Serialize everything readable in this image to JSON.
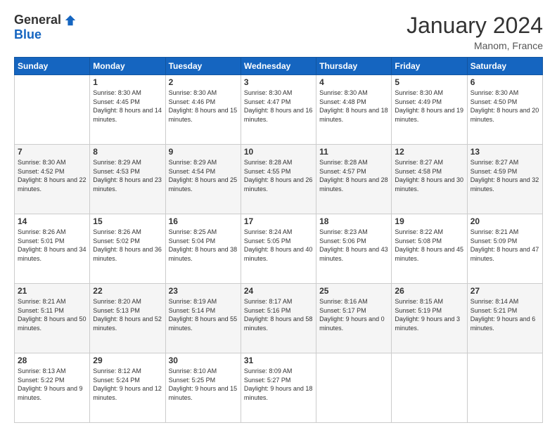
{
  "header": {
    "logo_general": "General",
    "logo_blue": "Blue",
    "month_title": "January 2024",
    "location": "Manom, France"
  },
  "days_of_week": [
    "Sunday",
    "Monday",
    "Tuesday",
    "Wednesday",
    "Thursday",
    "Friday",
    "Saturday"
  ],
  "weeks": [
    [
      {
        "day": "",
        "sunrise": "",
        "sunset": "",
        "daylight": ""
      },
      {
        "day": "1",
        "sunrise": "Sunrise: 8:30 AM",
        "sunset": "Sunset: 4:45 PM",
        "daylight": "Daylight: 8 hours and 14 minutes."
      },
      {
        "day": "2",
        "sunrise": "Sunrise: 8:30 AM",
        "sunset": "Sunset: 4:46 PM",
        "daylight": "Daylight: 8 hours and 15 minutes."
      },
      {
        "day": "3",
        "sunrise": "Sunrise: 8:30 AM",
        "sunset": "Sunset: 4:47 PM",
        "daylight": "Daylight: 8 hours and 16 minutes."
      },
      {
        "day": "4",
        "sunrise": "Sunrise: 8:30 AM",
        "sunset": "Sunset: 4:48 PM",
        "daylight": "Daylight: 8 hours and 18 minutes."
      },
      {
        "day": "5",
        "sunrise": "Sunrise: 8:30 AM",
        "sunset": "Sunset: 4:49 PM",
        "daylight": "Daylight: 8 hours and 19 minutes."
      },
      {
        "day": "6",
        "sunrise": "Sunrise: 8:30 AM",
        "sunset": "Sunset: 4:50 PM",
        "daylight": "Daylight: 8 hours and 20 minutes."
      }
    ],
    [
      {
        "day": "7",
        "sunrise": "Sunrise: 8:30 AM",
        "sunset": "Sunset: 4:52 PM",
        "daylight": "Daylight: 8 hours and 22 minutes."
      },
      {
        "day": "8",
        "sunrise": "Sunrise: 8:29 AM",
        "sunset": "Sunset: 4:53 PM",
        "daylight": "Daylight: 8 hours and 23 minutes."
      },
      {
        "day": "9",
        "sunrise": "Sunrise: 8:29 AM",
        "sunset": "Sunset: 4:54 PM",
        "daylight": "Daylight: 8 hours and 25 minutes."
      },
      {
        "day": "10",
        "sunrise": "Sunrise: 8:28 AM",
        "sunset": "Sunset: 4:55 PM",
        "daylight": "Daylight: 8 hours and 26 minutes."
      },
      {
        "day": "11",
        "sunrise": "Sunrise: 8:28 AM",
        "sunset": "Sunset: 4:57 PM",
        "daylight": "Daylight: 8 hours and 28 minutes."
      },
      {
        "day": "12",
        "sunrise": "Sunrise: 8:27 AM",
        "sunset": "Sunset: 4:58 PM",
        "daylight": "Daylight: 8 hours and 30 minutes."
      },
      {
        "day": "13",
        "sunrise": "Sunrise: 8:27 AM",
        "sunset": "Sunset: 4:59 PM",
        "daylight": "Daylight: 8 hours and 32 minutes."
      }
    ],
    [
      {
        "day": "14",
        "sunrise": "Sunrise: 8:26 AM",
        "sunset": "Sunset: 5:01 PM",
        "daylight": "Daylight: 8 hours and 34 minutes."
      },
      {
        "day": "15",
        "sunrise": "Sunrise: 8:26 AM",
        "sunset": "Sunset: 5:02 PM",
        "daylight": "Daylight: 8 hours and 36 minutes."
      },
      {
        "day": "16",
        "sunrise": "Sunrise: 8:25 AM",
        "sunset": "Sunset: 5:04 PM",
        "daylight": "Daylight: 8 hours and 38 minutes."
      },
      {
        "day": "17",
        "sunrise": "Sunrise: 8:24 AM",
        "sunset": "Sunset: 5:05 PM",
        "daylight": "Daylight: 8 hours and 40 minutes."
      },
      {
        "day": "18",
        "sunrise": "Sunrise: 8:23 AM",
        "sunset": "Sunset: 5:06 PM",
        "daylight": "Daylight: 8 hours and 43 minutes."
      },
      {
        "day": "19",
        "sunrise": "Sunrise: 8:22 AM",
        "sunset": "Sunset: 5:08 PM",
        "daylight": "Daylight: 8 hours and 45 minutes."
      },
      {
        "day": "20",
        "sunrise": "Sunrise: 8:21 AM",
        "sunset": "Sunset: 5:09 PM",
        "daylight": "Daylight: 8 hours and 47 minutes."
      }
    ],
    [
      {
        "day": "21",
        "sunrise": "Sunrise: 8:21 AM",
        "sunset": "Sunset: 5:11 PM",
        "daylight": "Daylight: 8 hours and 50 minutes."
      },
      {
        "day": "22",
        "sunrise": "Sunrise: 8:20 AM",
        "sunset": "Sunset: 5:13 PM",
        "daylight": "Daylight: 8 hours and 52 minutes."
      },
      {
        "day": "23",
        "sunrise": "Sunrise: 8:19 AM",
        "sunset": "Sunset: 5:14 PM",
        "daylight": "Daylight: 8 hours and 55 minutes."
      },
      {
        "day": "24",
        "sunrise": "Sunrise: 8:17 AM",
        "sunset": "Sunset: 5:16 PM",
        "daylight": "Daylight: 8 hours and 58 minutes."
      },
      {
        "day": "25",
        "sunrise": "Sunrise: 8:16 AM",
        "sunset": "Sunset: 5:17 PM",
        "daylight": "Daylight: 9 hours and 0 minutes."
      },
      {
        "day": "26",
        "sunrise": "Sunrise: 8:15 AM",
        "sunset": "Sunset: 5:19 PM",
        "daylight": "Daylight: 9 hours and 3 minutes."
      },
      {
        "day": "27",
        "sunrise": "Sunrise: 8:14 AM",
        "sunset": "Sunset: 5:21 PM",
        "daylight": "Daylight: 9 hours and 6 minutes."
      }
    ],
    [
      {
        "day": "28",
        "sunrise": "Sunrise: 8:13 AM",
        "sunset": "Sunset: 5:22 PM",
        "daylight": "Daylight: 9 hours and 9 minutes."
      },
      {
        "day": "29",
        "sunrise": "Sunrise: 8:12 AM",
        "sunset": "Sunset: 5:24 PM",
        "daylight": "Daylight: 9 hours and 12 minutes."
      },
      {
        "day": "30",
        "sunrise": "Sunrise: 8:10 AM",
        "sunset": "Sunset: 5:25 PM",
        "daylight": "Daylight: 9 hours and 15 minutes."
      },
      {
        "day": "31",
        "sunrise": "Sunrise: 8:09 AM",
        "sunset": "Sunset: 5:27 PM",
        "daylight": "Daylight: 9 hours and 18 minutes."
      },
      {
        "day": "",
        "sunrise": "",
        "sunset": "",
        "daylight": ""
      },
      {
        "day": "",
        "sunrise": "",
        "sunset": "",
        "daylight": ""
      },
      {
        "day": "",
        "sunrise": "",
        "sunset": "",
        "daylight": ""
      }
    ]
  ]
}
